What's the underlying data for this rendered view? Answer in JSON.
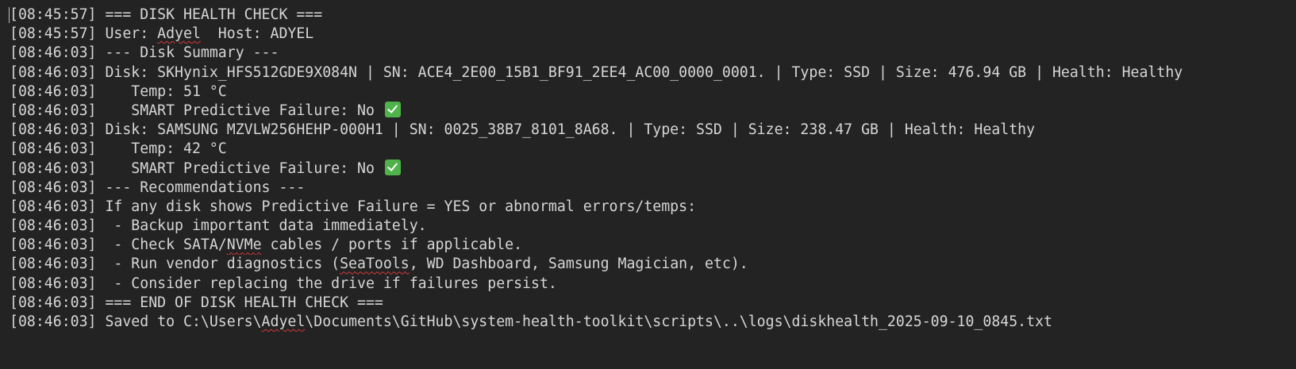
{
  "log_lines": [
    {
      "ts": "[08:45:57]",
      "text": " === DISK HEALTH CHECK ==="
    },
    {
      "ts": "[08:45:57]",
      "pre": " User: ",
      "flag": "Adyel",
      "post": "  Host: ADYEL"
    },
    {
      "ts": "[08:46:03]",
      "text": " --- Disk Summary ---"
    },
    {
      "ts": "[08:46:03]",
      "text": " Disk: SKHynix_HFS512GDE9X084N | SN: ACE4_2E00_15B1_BF91_2EE4_AC00_0000_0001. | Type: SSD | Size: 476.94 GB | Health: Healthy"
    },
    {
      "ts": "[08:46:03]",
      "text": "    Temp: 51 °C"
    },
    {
      "ts": "[08:46:03]",
      "text": "    SMART Predictive Failure: No ",
      "status_icon": "white-check-mark-icon"
    },
    {
      "ts": "[08:46:03]",
      "text": " Disk: SAMSUNG MZVLW256HEHP-000H1 | SN: 0025_38B7_8101_8A68. | Type: SSD | Size: 238.47 GB | Health: Healthy"
    },
    {
      "ts": "[08:46:03]",
      "text": "    Temp: 42 °C"
    },
    {
      "ts": "[08:46:03]",
      "text": "    SMART Predictive Failure: No ",
      "status_icon": "white-check-mark-icon"
    },
    {
      "ts": "[08:46:03]",
      "text": " --- Recommendations ---"
    },
    {
      "ts": "[08:46:03]",
      "text": " If any disk shows Predictive Failure = YES or abnormal errors/temps:"
    },
    {
      "ts": "[08:46:03]",
      "text": "  - Backup important data immediately."
    },
    {
      "ts": "[08:46:03]",
      "pre": "  - Check SATA/",
      "flag": "NVMe",
      "post": " cables / ports if applicable."
    },
    {
      "ts": "[08:46:03]",
      "pre": "  - Run vendor diagnostics (",
      "flag": "SeaTools",
      "post": ", WD Dashboard, Samsung Magician, etc)."
    },
    {
      "ts": "[08:46:03]",
      "text": "  - Consider replacing the drive if failures persist."
    },
    {
      "ts": "[08:46:03]",
      "text": " === END OF DISK HEALTH CHECK ==="
    },
    {
      "ts": "[08:46:03]",
      "pre": " Saved to C:\\Users\\",
      "flag": "Adyel",
      "post": "\\Documents\\GitHub\\system-health-toolkit\\scripts\\..\\logs\\diskhealth_2025-09-10_0845.txt"
    }
  ],
  "colors": {
    "background": "#232323",
    "text": "#d6d6d6",
    "check_icon": "#4fb24a",
    "spellcheck_underline": "#d83a3a"
  }
}
